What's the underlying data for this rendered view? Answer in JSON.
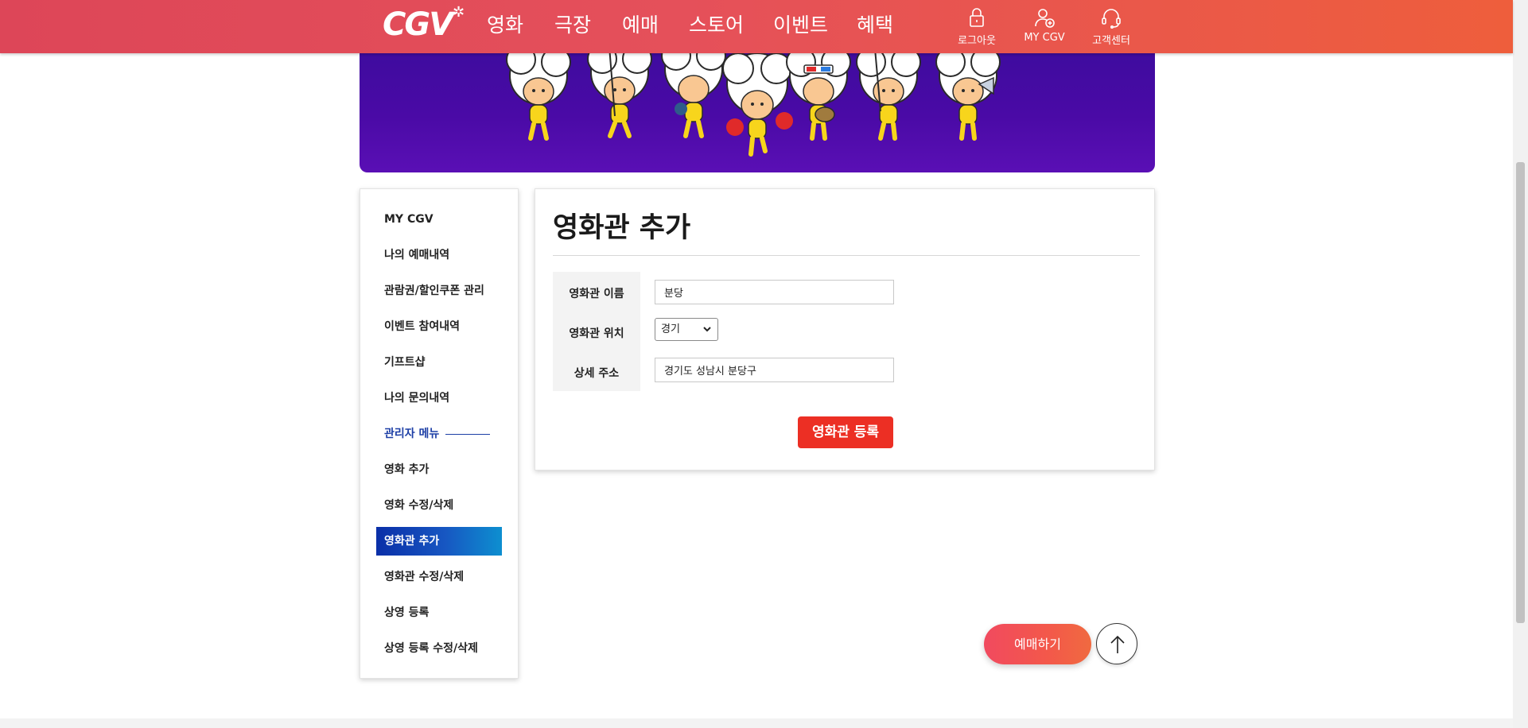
{
  "header": {
    "logo_text": "CGV",
    "nav": [
      {
        "label": "영화"
      },
      {
        "label": "극장"
      },
      {
        "label": "예매"
      },
      {
        "label": "스토어"
      },
      {
        "label": "이벤트"
      },
      {
        "label": "혜택"
      }
    ],
    "utility": [
      {
        "label": "로그아웃",
        "icon": "lock-icon"
      },
      {
        "label": "MY CGV",
        "icon": "user-add-icon"
      },
      {
        "label": "고객센터",
        "icon": "headset-icon"
      }
    ]
  },
  "banner": {
    "theme": "cgv-mascot-parade"
  },
  "sidebar": {
    "items": [
      {
        "label": "MY CGV",
        "kind": "link"
      },
      {
        "label": "나의 예매내역",
        "kind": "link"
      },
      {
        "label": "관람권/할인쿠폰 관리",
        "kind": "link"
      },
      {
        "label": "이벤트 참여내역",
        "kind": "link"
      },
      {
        "label": "기프트샵",
        "kind": "link"
      },
      {
        "label": "나의 문의내역",
        "kind": "link"
      },
      {
        "label": "관리자 메뉴",
        "kind": "section"
      },
      {
        "label": "영화 추가",
        "kind": "link"
      },
      {
        "label": "영화 수정/삭제",
        "kind": "link"
      },
      {
        "label": "영화관 추가",
        "kind": "active"
      },
      {
        "label": "영화관 수정/삭제",
        "kind": "link"
      },
      {
        "label": "상영 등록",
        "kind": "link"
      },
      {
        "label": "상영 등록 수정/삭제",
        "kind": "link"
      }
    ]
  },
  "form": {
    "title": "영화관 추가",
    "name_label": "영화관 이름",
    "name_value": "분당",
    "location_label": "영화관 위치",
    "location_value": "경기",
    "address_label": "상세 주소",
    "address_value": "경기도 성남시 분당구",
    "submit_label": "영화관 등록"
  },
  "floating": {
    "reserve_label": "예매하기"
  },
  "colors": {
    "header_start": "#dd4658",
    "header_end": "#ee5e3c",
    "banner": "#4a0aa6",
    "accent_red": "#ec2f24",
    "active_blue": "#1757c2",
    "section_blue": "#1d3fa6"
  }
}
